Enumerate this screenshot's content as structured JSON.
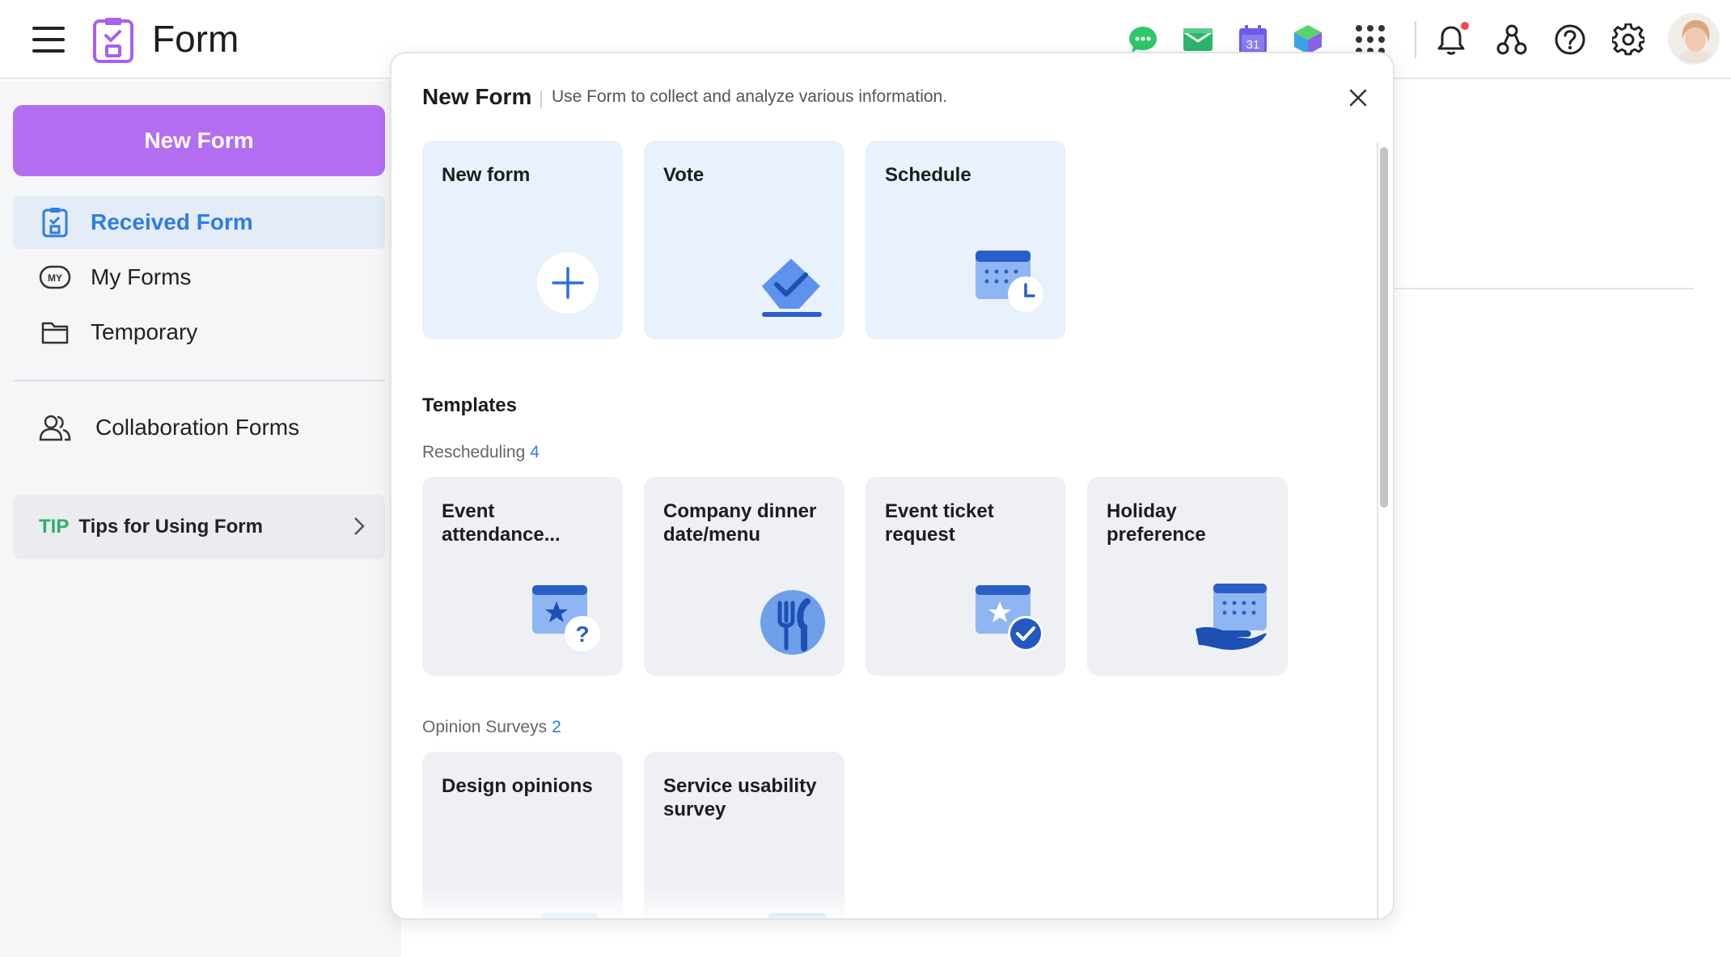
{
  "app": {
    "title": "Form"
  },
  "header": {
    "icons": [
      "hamburger-icon",
      "messenger-icon",
      "mail-icon",
      "calendar-icon",
      "drive-icon",
      "apps-grid-icon",
      "bell-icon",
      "org-chart-icon",
      "help-icon",
      "gear-icon"
    ],
    "calendar_day": "31",
    "notification_dot_color": "#f04a4a"
  },
  "sidebar": {
    "new_form_label": "New Form",
    "items": [
      {
        "label": "Received Form",
        "icon": "clipboard-icon",
        "active": true
      },
      {
        "label": "My Forms",
        "icon": "my-badge-icon",
        "badge": "MY"
      },
      {
        "label": "Temporary",
        "icon": "folder-icon"
      },
      {
        "label": "Collaboration Forms",
        "icon": "people-icon"
      }
    ],
    "tip": {
      "tag": "TIP",
      "text": "Tips for Using Form"
    }
  },
  "modal": {
    "title": "New Form",
    "subtitle": "Use Form to collect and analyze various information.",
    "quick_cards": [
      {
        "label": "New form",
        "icon": "plus-icon"
      },
      {
        "label": "Vote",
        "icon": "vote-check-icon"
      },
      {
        "label": "Schedule",
        "icon": "calendar-clock-icon"
      }
    ],
    "templates_title": "Templates",
    "categories": [
      {
        "name": "Rescheduling",
        "count": "4",
        "cards": [
          {
            "label": "Event attendance...",
            "icon": "calendar-star-question-icon"
          },
          {
            "label": "Company dinner date/menu",
            "icon": "fork-knife-icon"
          },
          {
            "label": "Event ticket request",
            "icon": "calendar-star-check-icon"
          },
          {
            "label": "Holiday preference",
            "icon": "calendar-hand-icon"
          }
        ]
      },
      {
        "name": "Opinion Surveys",
        "count": "2",
        "cards": [
          {
            "label": "Design opinions",
            "icon": "design-shapes-icon"
          },
          {
            "label": "Service usability survey",
            "icon": "devices-icon"
          }
        ]
      }
    ]
  },
  "colors": {
    "accent": "#b46ef2",
    "active_blue": "#2f7de1",
    "tip_green": "#27b36a",
    "card_blue": "#e8f1fc",
    "icon_blue": "#3b74e0"
  }
}
